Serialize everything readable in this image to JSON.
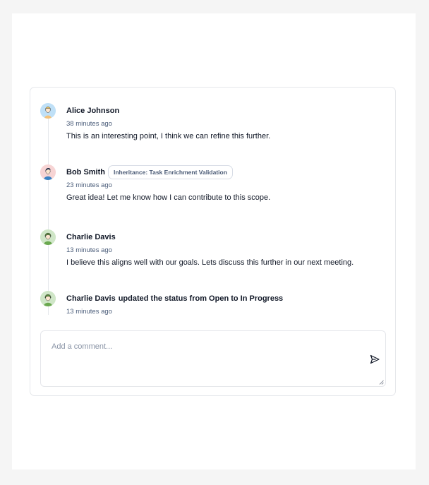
{
  "comments": [
    {
      "author": "Alice Johnson",
      "time": "38 minutes ago",
      "text": "This is an interesting point, I think we can refine this further.",
      "avatar_bg": "#bfe0f7",
      "avatar_icon": "avatar-blonde-person"
    },
    {
      "author": "Bob Smith",
      "tag": "Inheritance: Task Enrichment Validation",
      "time": "23 minutes ago",
      "text": "Great idea! Let me know how I can contribute to this scope.",
      "avatar_bg": "#f7d4d4",
      "avatar_icon": "avatar-dark-hair-person"
    },
    {
      "author": "Charlie Davis",
      "time": "13 minutes ago",
      "text": "I believe this aligns well with our goals. Lets discuss this further in our next meeting.",
      "avatar_bg": "#cfe6c7",
      "avatar_icon": "avatar-green-person"
    }
  ],
  "status_update": {
    "author": "Charlie Davis",
    "text": "updated the status from Open to In Progress",
    "time": "13 minutes ago",
    "avatar_bg": "#cfe6c7",
    "avatar_icon": "avatar-green-person"
  },
  "composer": {
    "placeholder": "Add a comment...",
    "send_icon": "send-icon"
  }
}
